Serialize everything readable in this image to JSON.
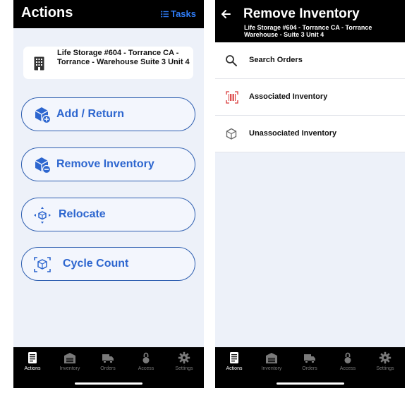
{
  "left": {
    "header": {
      "title": "Actions",
      "tasks_label": "Tasks"
    },
    "location": {
      "name": "Life Storage #604 - Torrance CA - Torrance - Warehouse Suite 3 Unit 4"
    },
    "actions": [
      {
        "label": "Add / Return",
        "icon": "box-plus-icon"
      },
      {
        "label": "Remove Inventory",
        "icon": "box-minus-icon"
      },
      {
        "label": "Relocate",
        "icon": "relocate-icon"
      },
      {
        "label": "Cycle Count",
        "icon": "cycle-count-icon"
      }
    ]
  },
  "right": {
    "header": {
      "title": "Remove Inventory",
      "subtitle": "Life Storage #604 - Torrance CA - Torrance Warehouse - Suite 3 Unit 4"
    },
    "menu": [
      {
        "label": "Search Orders",
        "icon": "search-icon"
      },
      {
        "label": "Associated Inventory",
        "icon": "barcode-icon"
      },
      {
        "label": "Unassociated Inventory",
        "icon": "box-icon"
      }
    ]
  },
  "tabs": [
    "Actions",
    "Inventory",
    "Orders",
    "Access",
    "Settings"
  ],
  "colors": {
    "accent": "#2d66cf",
    "header_bg": "#000000",
    "page_bg": "#edf1f9",
    "barcode_red": "#d93a3a"
  }
}
